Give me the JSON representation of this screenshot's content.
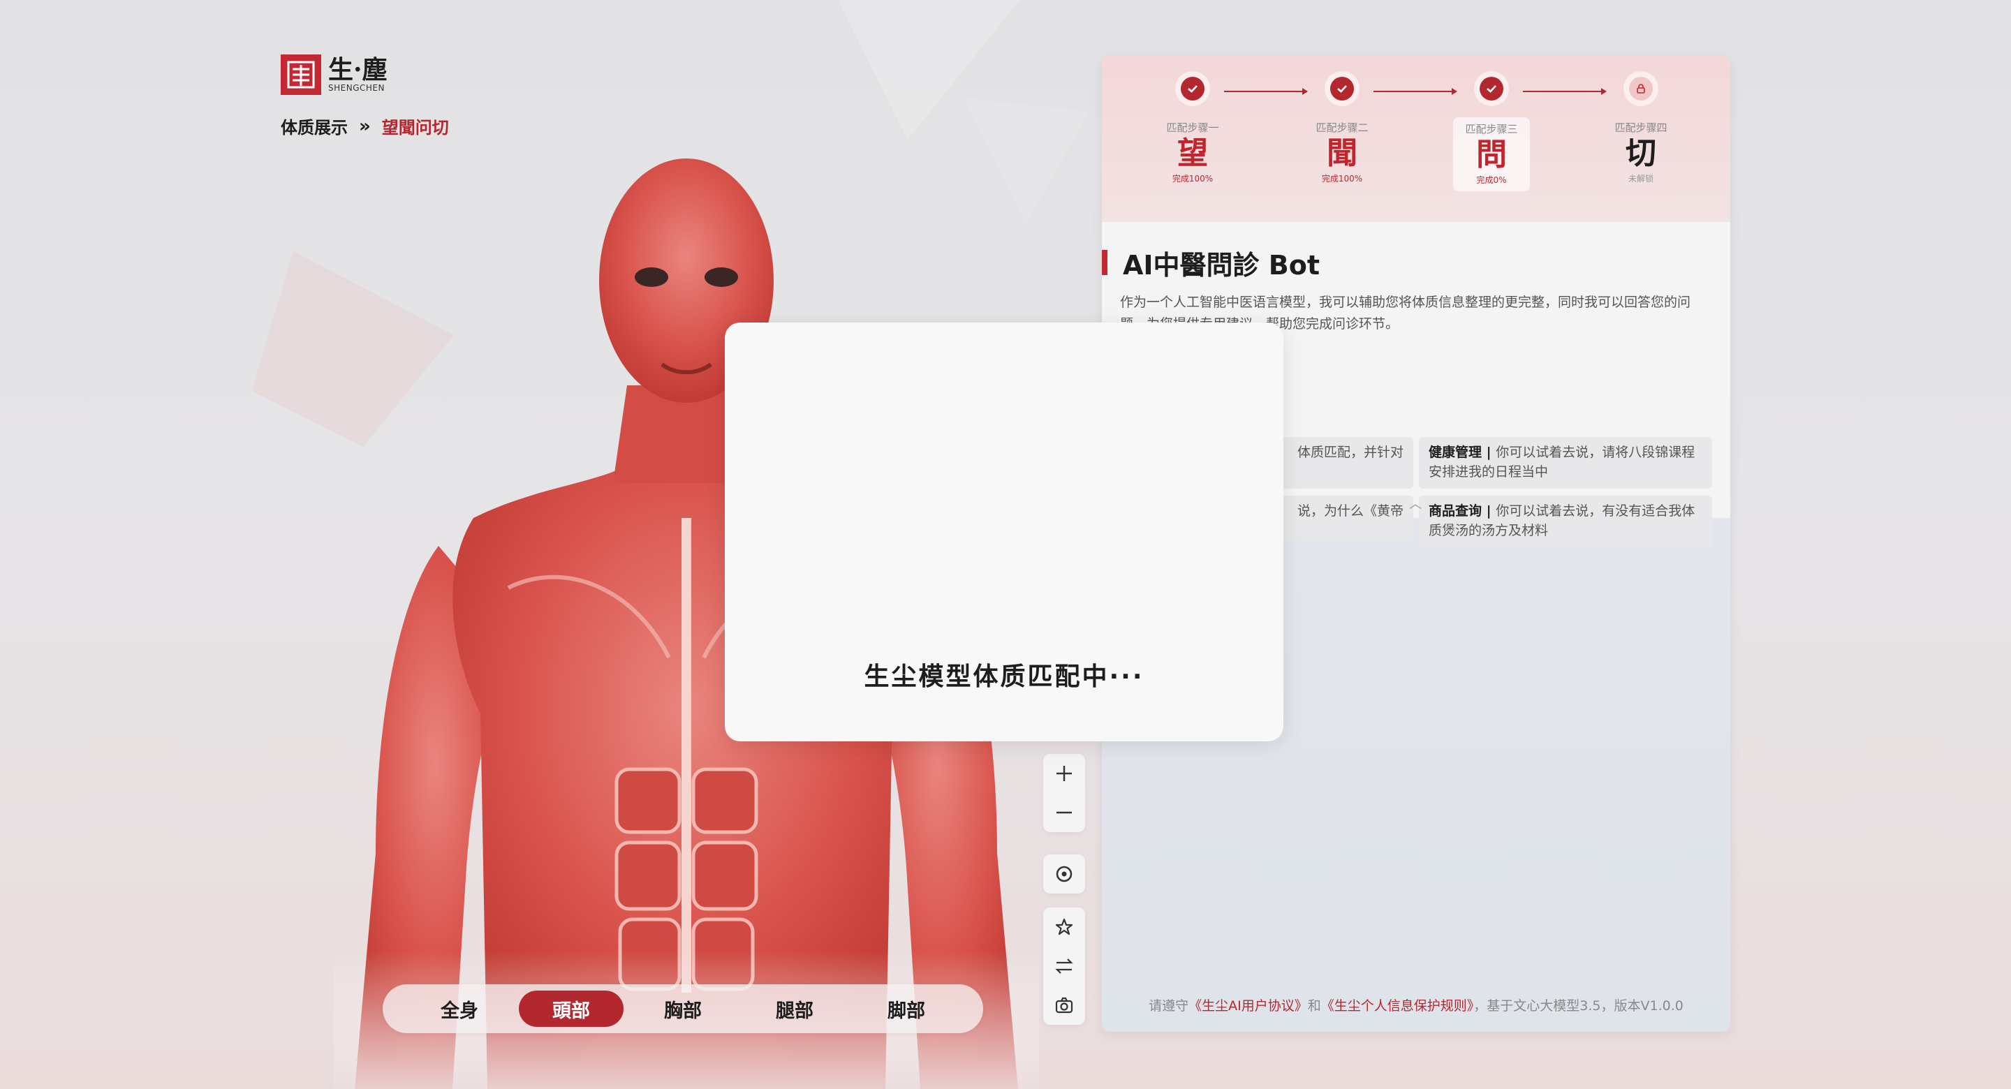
{
  "brand": {
    "name_cn": "生·塵",
    "name_en": "SHENGCHEN"
  },
  "breadcrumb": {
    "home": "体质展示",
    "separator": "»",
    "current": "望聞问切"
  },
  "tabs": [
    {
      "label": "全身",
      "active": false
    },
    {
      "label": "頭部",
      "active": true
    },
    {
      "label": "胸部",
      "active": false
    },
    {
      "label": "腿部",
      "active": false
    },
    {
      "label": "脚部",
      "active": false
    }
  ],
  "tools": {
    "zoom_in": "plus-icon",
    "zoom_out": "minus-icon",
    "locate": "target-icon",
    "favorite": "star-icon",
    "switch": "swap-arrows-icon",
    "snapshot": "camera-icon"
  },
  "steps": [
    {
      "label": "匹配步骤一",
      "char": "望",
      "progress": "完成100%",
      "state": "done"
    },
    {
      "label": "匹配步骤二",
      "char": "聞",
      "progress": "完成100%",
      "state": "done"
    },
    {
      "label": "匹配步骤三",
      "char": "問",
      "progress": "完成0%",
      "state": "done"
    },
    {
      "label": "匹配步骤四",
      "char": "切",
      "progress": "未解锁",
      "state": "locked"
    }
  ],
  "intro": {
    "title": "AI中醫問診 Bot",
    "description": "作为一个人工智能中医语言模型，我可以辅助您将体质信息整理的更完整，同时我可以回答您的问题，为您提供专用建议，帮助您完成问诊环节。",
    "cards": [
      {
        "tag": "",
        "text": "体质匹配，并针对"
      },
      {
        "tag": "健康管理",
        "text": "你可以试着去说，请将八段锦课程安排进我的日程当中"
      },
      {
        "tag": "",
        "text": "说，为什么《黄帝"
      },
      {
        "tag": "商品查询",
        "text": "你可以试着去说，有没有适合我体质煲汤的汤方及材料"
      }
    ],
    "collapse_icon": "chevron-up-icon"
  },
  "footer": {
    "prefix": "请遵守",
    "link1": "《生尘AI用户协议》",
    "and": "和",
    "link2": "《生尘个人信息保护规则》",
    "suffix": "，基于文心大模型3.5，版本V1.0.0"
  },
  "modal": {
    "text": "生尘模型体质匹配中···"
  },
  "colors": {
    "accent": "#b3272f",
    "brand": "#c42832",
    "panel_bg": "#e4e7ec"
  }
}
